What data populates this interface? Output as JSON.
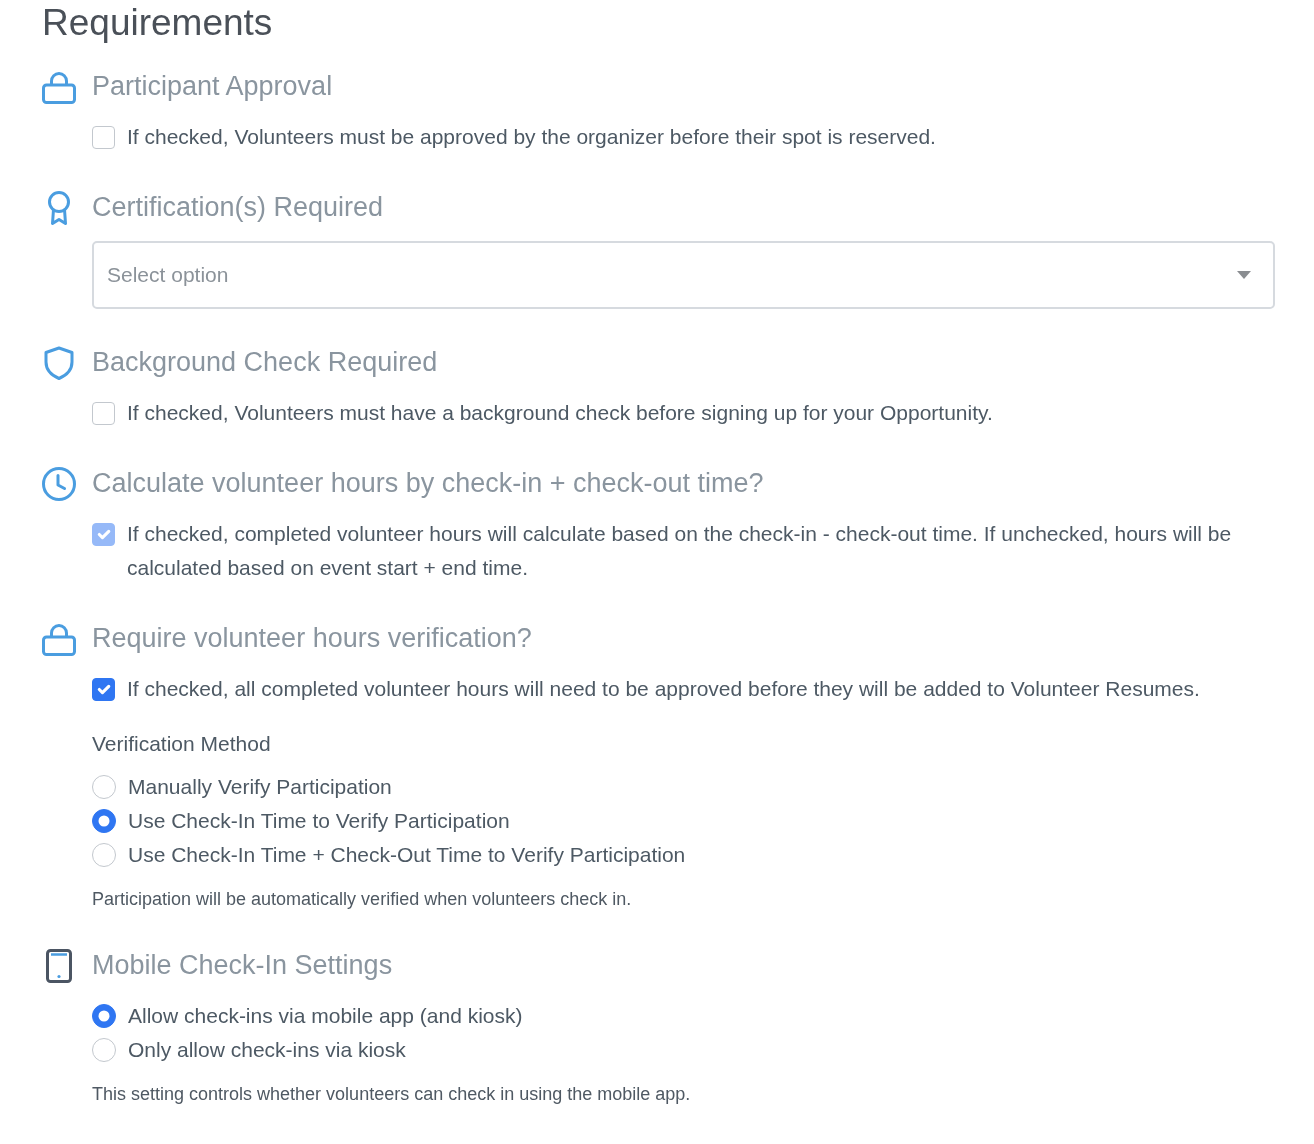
{
  "page": {
    "title": "Requirements"
  },
  "sections": [
    {
      "heading": "Participant Approval",
      "controls": [
        {
          "kind": "checkbox",
          "label": "If checked, Volunteers must be approved by the organizer before their spot is reserved.",
          "checked": false,
          "disabled": false
        }
      ]
    },
    {
      "heading": "Certification(s) Required",
      "controls": [
        {
          "kind": "select",
          "placeholder": "Select option"
        }
      ]
    },
    {
      "heading": "Background Check Required",
      "controls": [
        {
          "kind": "checkbox",
          "label": "If checked, Volunteers must have a background check before signing up for your Opportunity.",
          "checked": false,
          "disabled": false
        }
      ]
    },
    {
      "heading": "Calculate volunteer hours by check-in + check-out time?",
      "controls": [
        {
          "kind": "checkbox",
          "label": "If checked, completed volunteer hours will calculate based on the check-in - check-out time. If unchecked, hours will be calculated based on event start + end time.",
          "checked": true,
          "disabled": true
        }
      ]
    },
    {
      "heading": "Require volunteer hours verification?",
      "controls": [
        {
          "kind": "checkbox",
          "label": "If checked, all completed volunteer hours will need to be approved before they will be added to Volunteer Resumes.",
          "checked": true,
          "disabled": false
        },
        {
          "kind": "label",
          "text": "Verification Method"
        },
        {
          "kind": "radio_group",
          "options": [
            {
              "label": "Manually Verify Participation",
              "selected": false
            },
            {
              "label": "Use Check-In Time to Verify Participation",
              "selected": true
            },
            {
              "label": "Use Check-In Time + Check-Out Time to Verify Participation",
              "selected": false
            }
          ]
        },
        {
          "kind": "help",
          "text": "Participation will be automatically verified when volunteers check in."
        }
      ]
    },
    {
      "heading": "Mobile Check-In Settings",
      "controls": [
        {
          "kind": "radio_group",
          "options": [
            {
              "label": "Allow check-ins via mobile app (and kiosk)",
              "selected": true
            },
            {
              "label": "Only allow check-ins via kiosk",
              "selected": false
            }
          ]
        },
        {
          "kind": "help",
          "text": "This setting controls whether volunteers can check in using the mobile app."
        }
      ]
    }
  ]
}
